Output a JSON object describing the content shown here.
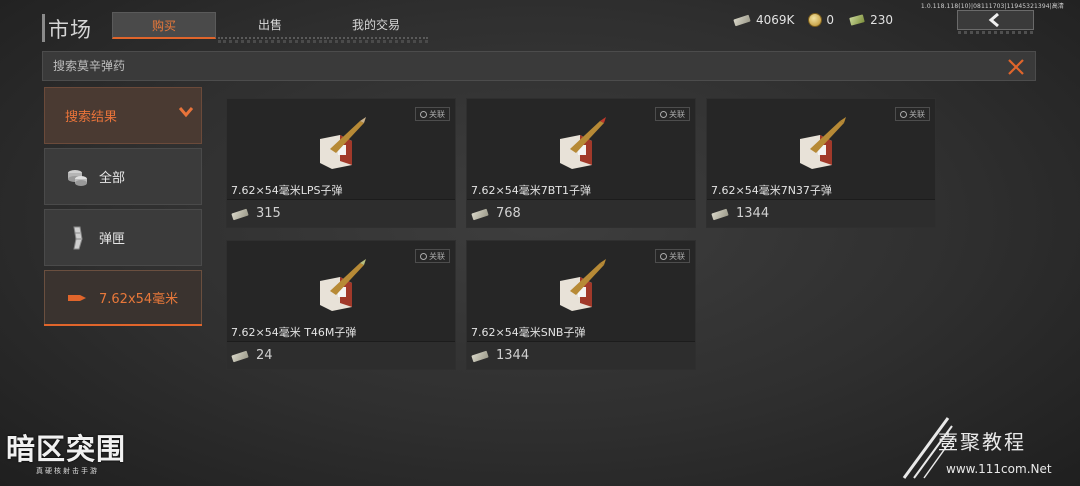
{
  "version_text": "1.0.118.118(10)|08111703|11945321394|高清",
  "header": {
    "title": "市场",
    "tabs": [
      {
        "label": "购买",
        "active": true
      },
      {
        "label": "出售",
        "active": false
      },
      {
        "label": "我的交易",
        "active": false
      }
    ]
  },
  "currencies": [
    {
      "icon": "cash-icon",
      "value": "4069K"
    },
    {
      "icon": "coin-icon",
      "value": "0"
    },
    {
      "icon": "bond-icon",
      "value": "230"
    }
  ],
  "search": {
    "placeholder": "搜索莫辛弹药",
    "value": ""
  },
  "sidebar": {
    "items": [
      {
        "label": "搜索结果",
        "icon": "chevron-down-icon",
        "state": "expanded"
      },
      {
        "label": "全部",
        "icon": "coins-icon"
      },
      {
        "label": "弹匣",
        "icon": "magazine-icon"
      },
      {
        "label": "7.62x54毫米",
        "icon": "bullet-icon",
        "selected": true
      }
    ]
  },
  "items": [
    {
      "name": "7.62×54毫米LPS子弹",
      "price": "315",
      "link_label": "关联"
    },
    {
      "name": "7.62×54毫米7BT1子弹",
      "price": "768",
      "link_label": "关联"
    },
    {
      "name": "7.62×54毫米7N37子弹",
      "price": "1344",
      "link_label": "关联"
    },
    {
      "name": "7.62×54毫米 T46M子弹",
      "price": "24",
      "link_label": "关联"
    },
    {
      "name": "7.62×54毫米SNB子弹",
      "price": "1344",
      "link_label": "关联"
    }
  ],
  "branding": {
    "game_logo": "暗区突围",
    "game_slogan": "真硬核射击手游",
    "watermark_title": "壹聚教程",
    "watermark_url": "www.111com.Net"
  },
  "colors": {
    "accent": "#e0652b",
    "background": "#2f2f2f",
    "card": "#262626"
  }
}
